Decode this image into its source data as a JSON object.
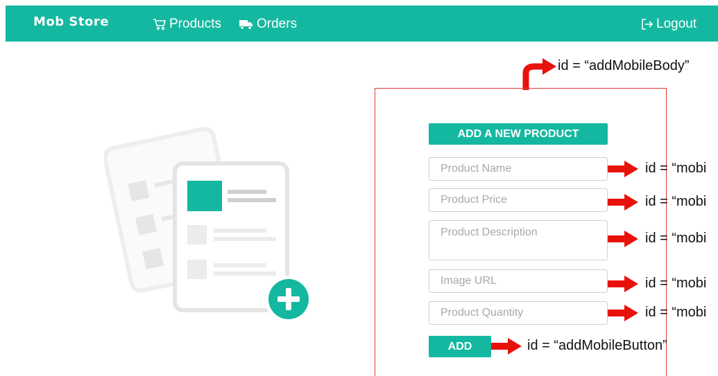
{
  "navbar": {
    "brand": "Mob Store",
    "products_label": "Products",
    "orders_label": "Orders",
    "logout_label": "Logout",
    "bg_color": "#14b8a0"
  },
  "form": {
    "title": "ADD A NEW PRODUCT",
    "name_placeholder": "Product Name",
    "price_placeholder": "Product Price",
    "description_placeholder": "Product Description",
    "image_placeholder": "Image URL",
    "quantity_placeholder": "Product Quantity",
    "add_label": "ADD"
  },
  "annotations": {
    "body_id": "id = “addMobileBody”",
    "name_id": "id = “mobi",
    "price_id": "id = “mobi",
    "description_id": "id = “mobi",
    "image_id": "id = “mobi",
    "quantity_id": "id = “mobi",
    "button_id": "id = “addMobileButton”",
    "arrow_color": "#e8120c"
  },
  "icons": {
    "products": "cart-icon",
    "orders": "truck-icon",
    "logout": "logout-icon",
    "illustration": "add-product-illustration"
  }
}
